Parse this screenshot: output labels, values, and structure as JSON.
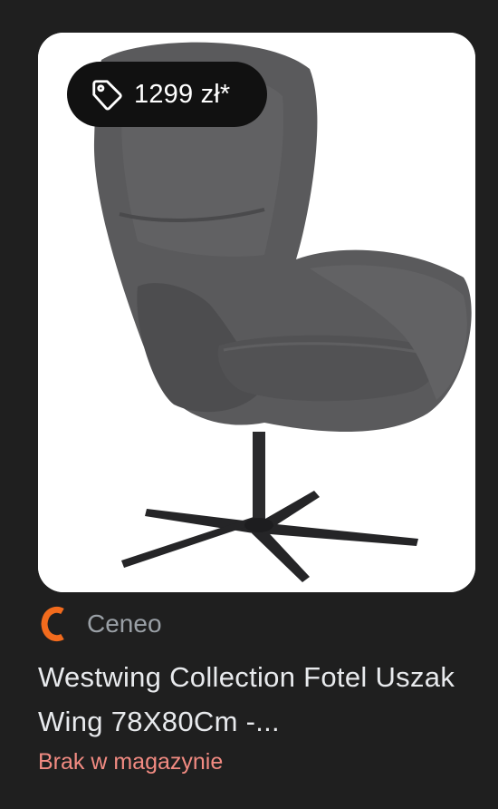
{
  "product": {
    "price_label": "1299 zł*",
    "image_description_icon": "wing-armchair-image",
    "source": {
      "name": "Ceneo",
      "logo_icon": "ceneo-logo-icon",
      "logo_color": "#f26b1d"
    },
    "title": "Westwing Collection Fotel Uszak Wing 78X80Cm -...",
    "availability": "Brak w magazynie",
    "availability_color": "#f28b82"
  },
  "icons": {
    "price_tag": "tag-icon"
  }
}
